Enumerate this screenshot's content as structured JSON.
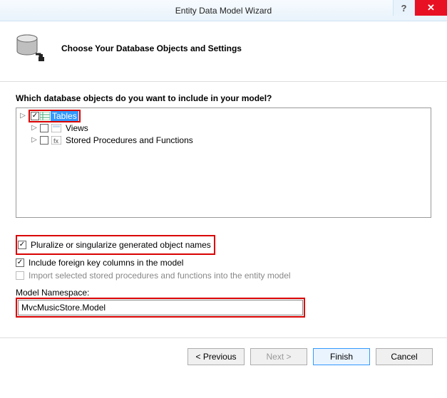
{
  "window": {
    "title": "Entity Data Model Wizard",
    "help": "?",
    "close": "✕"
  },
  "header": {
    "title": "Choose Your Database Objects and Settings"
  },
  "content": {
    "question": "Which database objects do you want to include in your model?",
    "tree": {
      "items": [
        {
          "label": "Tables",
          "checked": true,
          "selected": true,
          "expandable": true
        },
        {
          "label": "Views",
          "checked": false,
          "selected": false,
          "expandable": true
        },
        {
          "label": "Stored Procedures and Functions",
          "checked": false,
          "selected": false,
          "expandable": true
        }
      ]
    },
    "options": {
      "pluralize": {
        "label": "Pluralize or singularize generated object names",
        "checked": true
      },
      "fkeys": {
        "label": "Include foreign key columns in the model",
        "checked": true
      },
      "import_sp": {
        "label": "Import selected stored procedures and functions into the entity model",
        "checked": false,
        "disabled": true
      }
    },
    "namespace": {
      "label": "Model Namespace:",
      "value": "MvcMusicStore.Model"
    }
  },
  "footer": {
    "previous": "< Previous",
    "next": "Next >",
    "finish": "Finish",
    "cancel": "Cancel"
  }
}
